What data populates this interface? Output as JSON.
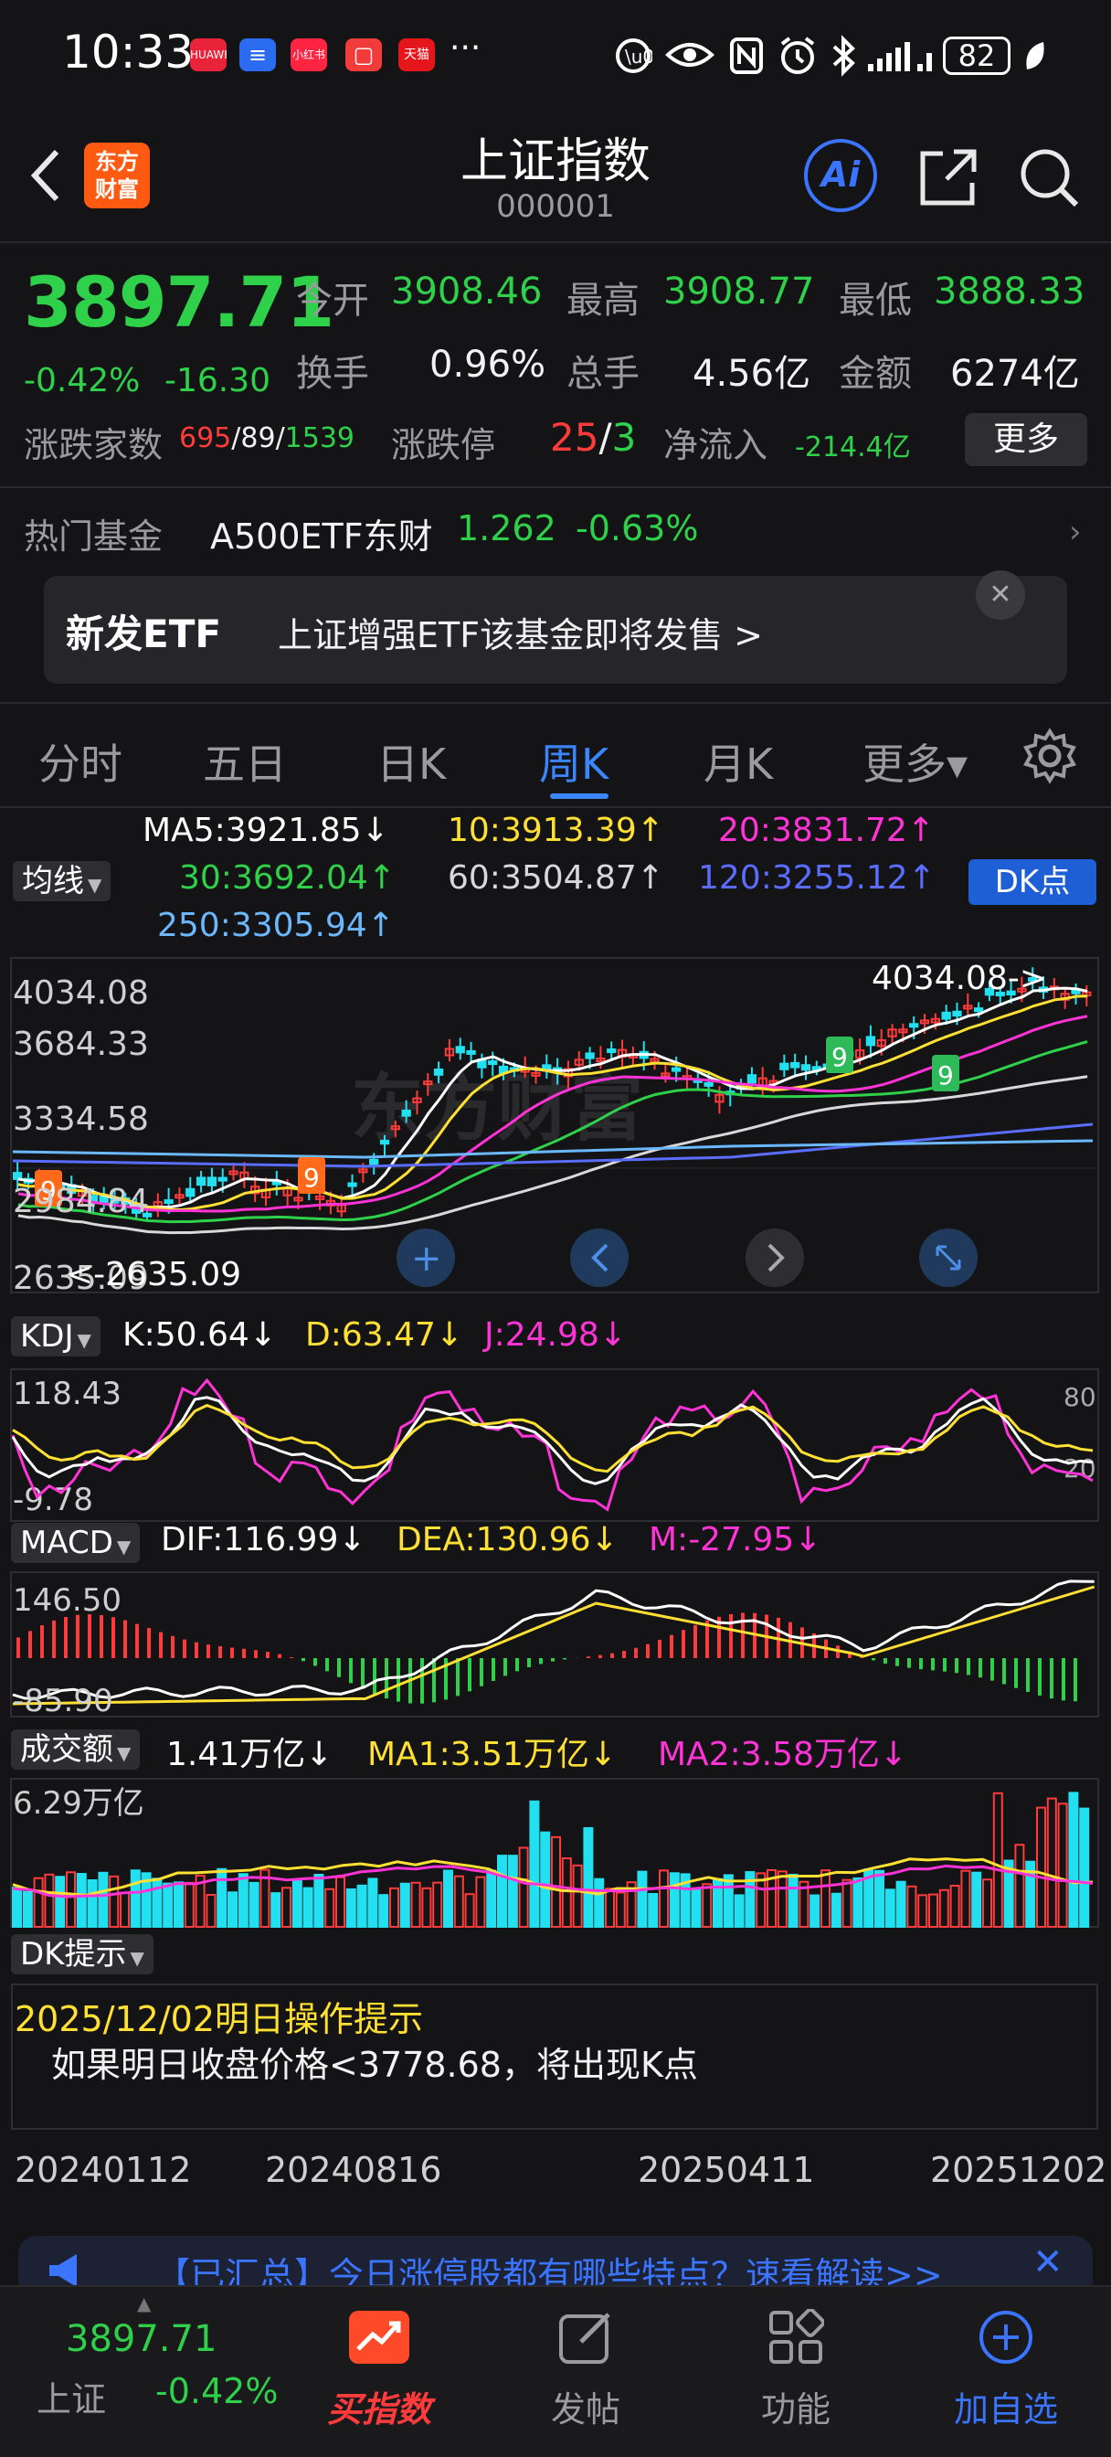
{
  "status_bar": {
    "time": "10:33",
    "apps": [
      {
        "name": "huawei-app-icon",
        "label": "HUAWEI",
        "color": "#e8233a"
      },
      {
        "name": "blue-app-icon",
        "label": "≡",
        "color": "#2a6bef"
      },
      {
        "name": "xiaohongshu-icon",
        "label": "小红书",
        "color": "#ff2442"
      },
      {
        "name": "red-app-icon",
        "label": "▢",
        "color": "#f23c3c"
      },
      {
        "name": "tmall-icon",
        "label": "天猫",
        "color": "#e4151b"
      }
    ],
    "more": "···",
    "battery": "82"
  },
  "header": {
    "logo_text_1": "东方",
    "logo_text_2": "财富",
    "title": "上证指数",
    "code": "000001",
    "ai_label": "Ai"
  },
  "quote": {
    "price": "3897.71",
    "change_pct": "-0.42%",
    "change_abs": "-16.30",
    "open_label": "今开",
    "open": "3908.46",
    "high_label": "最高",
    "high": "3908.77",
    "low_label": "最低",
    "low": "3888.33",
    "turnover_label": "换手",
    "turnover": "0.96%",
    "volume_label": "总手",
    "volume": "4.56亿",
    "amount_label": "金额",
    "amount": "6274亿",
    "breadth_label": "涨跌家数",
    "breadth_up": "695",
    "breadth_flat": "89",
    "breadth_down": "1539",
    "limit_label": "涨跌停",
    "limit_up": "25",
    "limit_down": "3",
    "netflow_label": "净流入",
    "netflow": "-214.4亿",
    "more_label": "更多"
  },
  "hot_fund": {
    "label": "热门基金",
    "name": "A500ETF东财",
    "price": "1.262",
    "pct": "-0.63%"
  },
  "banner": {
    "tag": "新发ETF",
    "text": "上证增强ETF该基金即将发售  >"
  },
  "tabs": [
    "分时",
    "五日",
    "日K",
    "周K",
    "月K",
    "更多▾"
  ],
  "ma_legend": {
    "selector": "均线",
    "ma5": "MA5:3921.85↓",
    "ma10": "10:3913.39↑",
    "ma20": "20:3831.72↑",
    "ma30": "30:3692.04↑",
    "ma60": "60:3504.87↑",
    "ma120": "120:3255.12↑",
    "ma250": "250:3305.94↑",
    "dk_button": "DK点"
  },
  "kline": {
    "y_labels": [
      "4034.08",
      "3684.33",
      "3334.58",
      "2984.84",
      "2635.09"
    ],
    "high_marker": "4034.08->",
    "low_marker": "<-2635.09",
    "colors": {
      "up": "#ff3b3b",
      "down": "#23e0f0",
      "ma5": "#ffffff",
      "ma10": "#ffe033",
      "ma20": "#ff33d6",
      "ma30": "#2fd04a",
      "ma60": "#d8d8d8",
      "ma120": "#5a6dff",
      "ma250": "#6cb8ff"
    }
  },
  "kdj": {
    "selector": "KDJ",
    "k": "K:50.64↓",
    "d": "D:63.47↓",
    "j": "J:24.98↓",
    "y_top": "118.43",
    "y_bottom": "-9.78",
    "ref_80": "80",
    "ref_20": "20"
  },
  "macd": {
    "selector": "MACD",
    "dif": "DIF:116.99↓",
    "dea": "DEA:130.96↓",
    "m": "M:-27.95↓",
    "y_top": "146.50",
    "y_bottom": "-85.90"
  },
  "volume": {
    "selector": "成交额",
    "current": "1.41万亿↓",
    "ma1": "MA1:3.51万亿↓",
    "ma2": "MA2:3.58万亿↓",
    "y_top": "6.29万亿"
  },
  "dk_hint": {
    "selector": "DK提示",
    "date": "2025/12/02明日操作提示",
    "text": "如果明日收盘价格<3778.68，将出现K点"
  },
  "x_dates": [
    "20240112",
    "20240816",
    "20250411",
    "20251202"
  ],
  "news_ticker": "【已汇总】今日涨停股都有哪些特点？速看解读>>",
  "bottom_bar": {
    "price": "3897.71",
    "name": "上证",
    "pct": "-0.42%",
    "buy_index": "买指数",
    "post": "发帖",
    "features": "功能",
    "add_watch": "加自选"
  }
}
